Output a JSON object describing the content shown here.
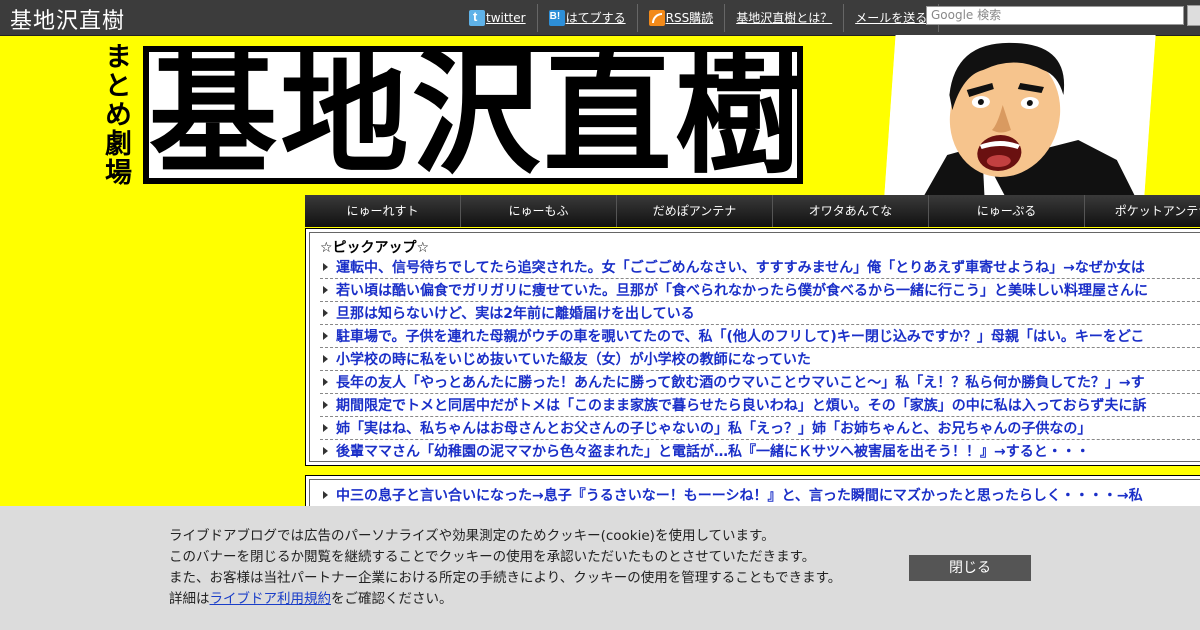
{
  "topbar": {
    "site_title": "基地沢直樹",
    "links": {
      "twitter": "twitter",
      "hatena": "はてブする",
      "rss": "RSS購読",
      "about": "基地沢直樹とは？",
      "mail": "メールを送る"
    },
    "search_placeholder": "Google 検索"
  },
  "header": {
    "subtitle": "まとめ劇場",
    "logo_chars": [
      "基",
      "地",
      "沢",
      "直",
      "樹"
    ]
  },
  "nav": {
    "items": [
      "にゅーれすト",
      "にゅーもふ",
      "だめぽアンテナ",
      "オワタあんてな",
      "にゅーぷる",
      "ポケットアンテナ"
    ]
  },
  "pickup": {
    "title": "☆ピックアップ☆",
    "items": [
      "運転中、信号待ちでしてたら追突された。女「ごごごめんなさい、すすすみません」俺「とりあえず車寄せようね」→なぜか女は",
      "若い頃は酷い偏食でガリガリに痩せていた。旦那が「食べられなかったら僕が食べるから一緒に行こう」と美味しい料理屋さんに",
      "旦那は知らないけど、実は2年前に離婚届けを出している",
      "駐車場で。子供を連れた母親がウチの車を覗いてたので、私「(他人のフリして)キー閉じ込みですか？」母親「はい。キーをどこ",
      "小学校の時に私をいじめ抜いていた級友（女）が小学校の教師になっていた",
      "長年の友人「やっとあんたに勝った！あんたに勝って飲む酒のウマいことウマいこと～」私「え！？私ら何か勝負してた？」→す",
      "期間限定でトメと同居中だがトメは「このまま家族で暮らせたら良いわね」と煩い。その「家族」の中に私は入っておらず夫に訴",
      "姉「実はね、私ちゃんはお母さんとお父さんの子じゃないの」私「えっ？」姉「お姉ちゃんと、お兄ちゃんの子供なの」",
      "後輩ママさん「幼稚園の泥ママから色々盗まれた」と電話が…私『一緒にＫサツへ被害届を出そう！！』→すると・・・"
    ]
  },
  "pickup2": {
    "item": "中三の息子と言い合いになった→息子『うるさいなー！もーーシね！』と、言った瞬間にマズかったと思ったらしく・・・・→私"
  },
  "cookie": {
    "line1": "ライブドアブログでは広告のパーソナライズや効果測定のためクッキー(cookie)を使用しています。",
    "line2": "このバナーを閉じるか閲覧を継続することでクッキーの使用を承認いただいたものとさせていただきます。",
    "line3": "また、お客様は当社パートナー企業における所定の手続きにより、クッキーの使用を管理することもできます。",
    "line4_prefix": "詳細は",
    "line4_link": "ライブドア利用規約",
    "line4_suffix": "をご確認ください。",
    "close_label": "閉じる"
  },
  "colors": {
    "background": "#ffff00",
    "topbar": "#3c3c3c",
    "link": "#1a2fc8"
  }
}
